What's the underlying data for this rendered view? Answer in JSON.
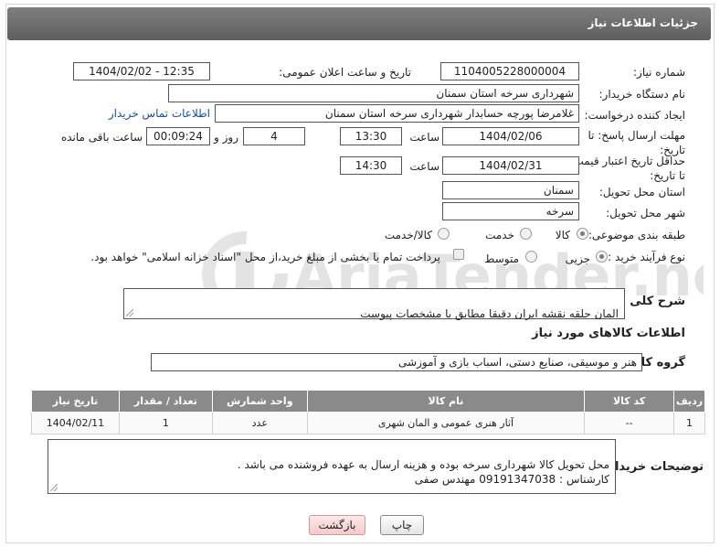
{
  "header": {
    "title": "جزئیات اطلاعات نیاز"
  },
  "fields": {
    "need_number_label": "شماره نیاز:",
    "need_number": "1104005228000004",
    "announce_label": "تاریخ و ساعت اعلان عمومی:",
    "announce_value": "1404/02/02 - 12:35",
    "buyer_org_label": "نام دستگاه خریدار:",
    "buyer_org": "شهرداری سرخه استان سمنان",
    "creator_label": "ایجاد کننده درخواست:",
    "creator": "غلامرضا پورچه حسابدار شهرداری سرخه استان سمنان",
    "contact_link": "اطلاعات تماس خریدار",
    "deadline_label": "مهلت ارسال پاسخ: تا تاریخ:",
    "deadline_date": "1404/02/06",
    "hour_label": "ساعت",
    "deadline_time": "13:30",
    "days_value": "4",
    "days_label": "روز و",
    "remaining_time": "00:09:24",
    "remaining_label": "ساعت باقی مانده",
    "price_valid_label": "حداقل تاریخ اعتبار قیمت: تا تاریخ:",
    "price_valid_date": "1404/02/31",
    "price_valid_hour_label": "ساعت",
    "price_valid_time": "14:30",
    "province_label": "استان محل تحویل:",
    "province": "سمنان",
    "city_label": "شهر محل تحویل:",
    "city": "سرخه",
    "category_label": "طبقه بندی موضوعی:",
    "category_options": [
      "کالا",
      "خدمت",
      "کالا/خدمت"
    ],
    "category_selected": "کالا",
    "process_label": "نوع فرآیند خرید :",
    "process_options": [
      "جزیی",
      "متوسط"
    ],
    "process_selected": "جزیی",
    "payment_note": "پرداخت تمام یا بخشی از مبلغ خرید،از محل \"اسناد خزانه اسلامی\" خواهد بود.",
    "description_label": "شرح کلی نیاز:",
    "description": "المان حلقه نقشه ایران دقیقا مطابق با مشخصات پیوست",
    "goods_info_title": "اطلاعات کالاهای مورد نیاز",
    "goods_group_label": "گروه کالا:",
    "goods_group": "هنر و موسیقی، صنایع دستی، اسباب بازی و آموزشی"
  },
  "table": {
    "headers": [
      "ردیف",
      "کد کالا",
      "نام کالا",
      "واحد شمارش",
      "تعداد / مقدار",
      "تاریخ نیاز"
    ],
    "rows": [
      [
        "1",
        "--",
        "آثار هنری عمومی و المان شهری",
        "عدد",
        "1",
        "1404/02/11"
      ]
    ]
  },
  "buyer_notes": {
    "label": "توضیحات خریدار:",
    "text": "محل تحویل کالا شهرداری سرخه بوده و هزینه ارسال به عهده فروشنده می باشد .\nکارشناس : 09191347038 مهندس صفی"
  },
  "buttons": {
    "print": "چاپ",
    "back": "بازگشت"
  },
  "watermark": {
    "text": "AriaTender.neT"
  }
}
